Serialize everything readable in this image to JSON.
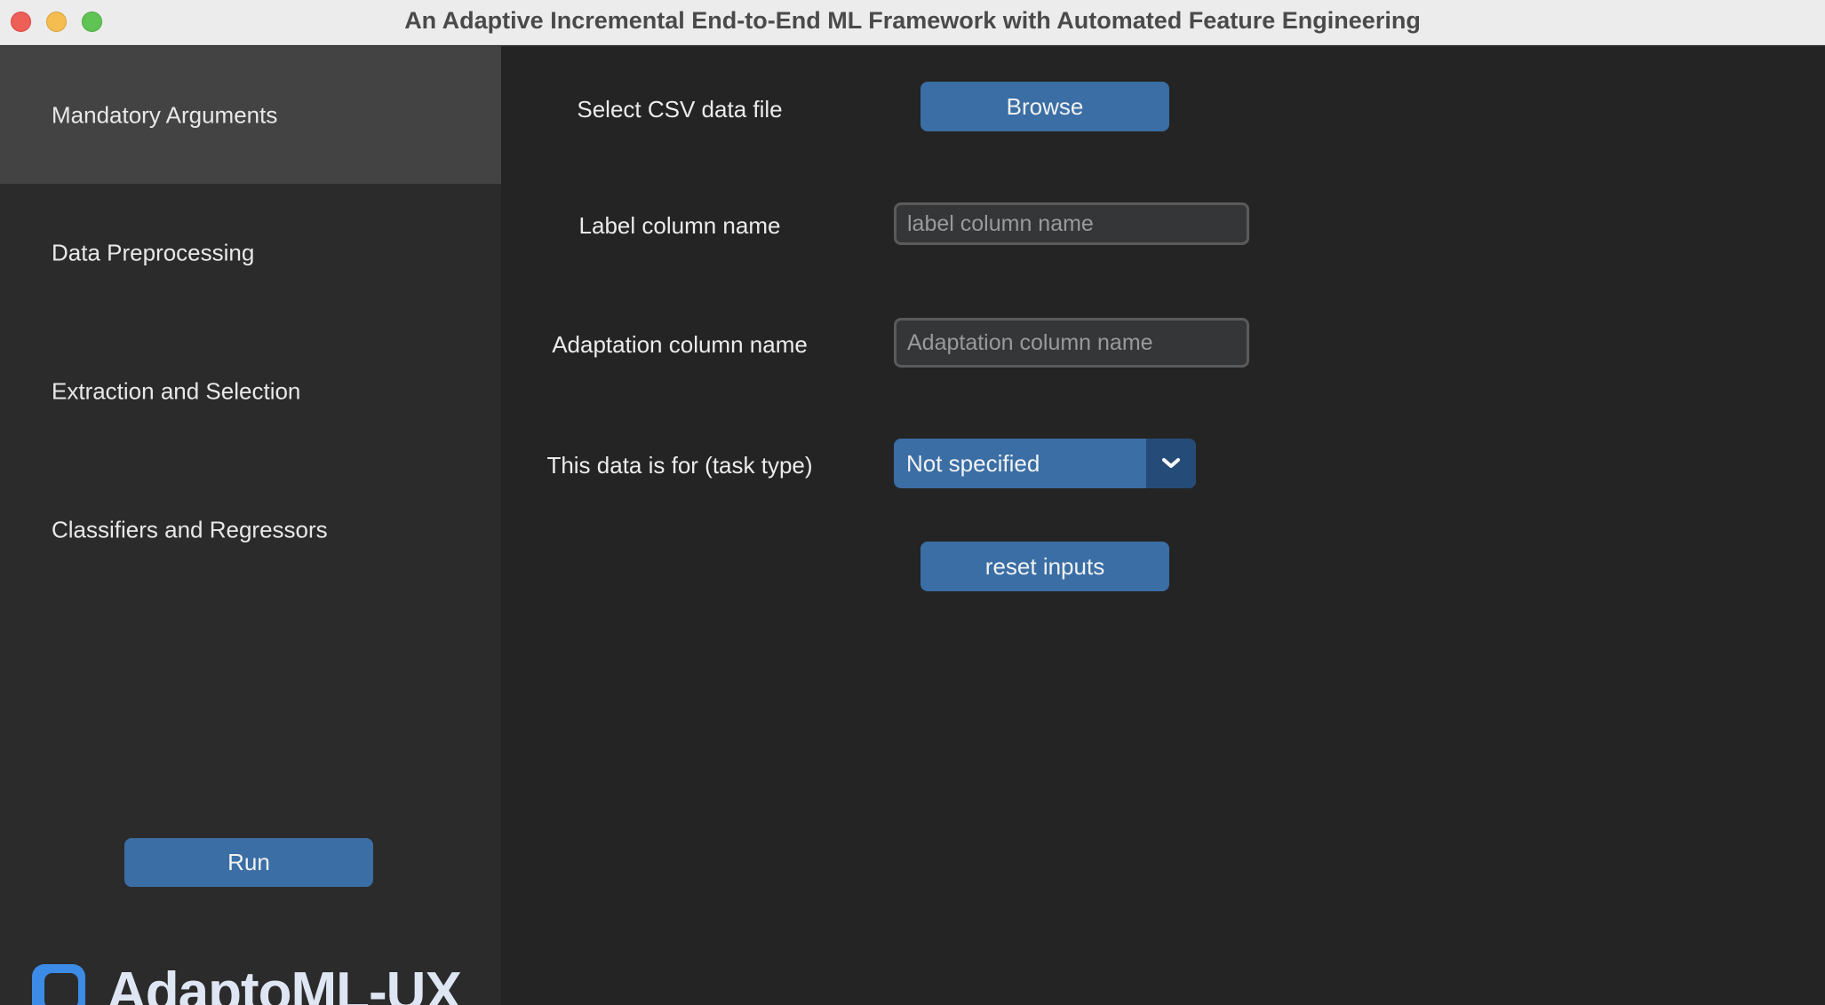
{
  "window": {
    "title": "An Adaptive Incremental End-to-End ML Framework with Automated Feature Engineering"
  },
  "sidebar": {
    "items": [
      {
        "label": "Mandatory Arguments",
        "active": true
      },
      {
        "label": "Data Preprocessing",
        "active": false
      },
      {
        "label": "Extraction and Selection",
        "active": false
      },
      {
        "label": "Classifiers and Regressors",
        "active": false
      }
    ],
    "run_label": "Run",
    "logo_text": "AdaptoML-UX"
  },
  "main": {
    "csv": {
      "label": "Select CSV data file",
      "button_label": "Browse"
    },
    "label_column": {
      "label": "Label column name",
      "placeholder": "label column name",
      "value": ""
    },
    "adaptation_column": {
      "label": "Adaptation column name",
      "placeholder": "Adaptation column name",
      "value": ""
    },
    "task_type": {
      "label": "This data is for (task type)",
      "selected": "Not specified"
    },
    "reset_label": "reset inputs"
  },
  "colors": {
    "accent": "#3a6ea5",
    "accent_dark": "#254c78",
    "sidebar_bg": "#2b2b2c",
    "sidebar_active_bg": "#434343",
    "main_bg": "#242424",
    "logo_blue": "#3c8ce7"
  },
  "icons": {
    "dropdown_arrow": "chevron-down-icon",
    "logo": "app-logo-icon"
  }
}
